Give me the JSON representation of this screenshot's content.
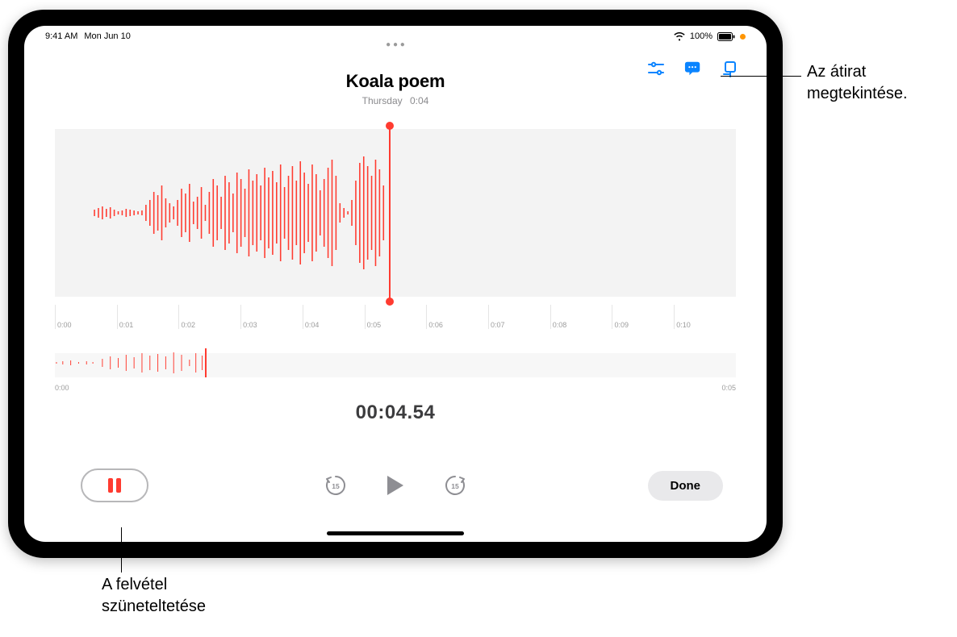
{
  "statusbar": {
    "time": "9:41 AM",
    "date": "Mon Jun 10",
    "battery_pct": "100%"
  },
  "title": {
    "name": "Koala poem",
    "day": "Thursday",
    "duration": "0:04"
  },
  "main_ruler": [
    "0:00",
    "0:01",
    "0:02",
    "0:03",
    "0:04",
    "0:05",
    "0:06",
    "0:07",
    "0:08",
    "0:09",
    "0:10"
  ],
  "overview_times": {
    "start": "0:00",
    "end": "0:05"
  },
  "timer": "00:04.54",
  "controls": {
    "back15_label": "15",
    "fwd15_label": "15",
    "done_label": "Done"
  },
  "callouts": {
    "transcript": "Az átirat\nmegtekintése.",
    "pause": "A felvétel\nszüneteltetése"
  }
}
